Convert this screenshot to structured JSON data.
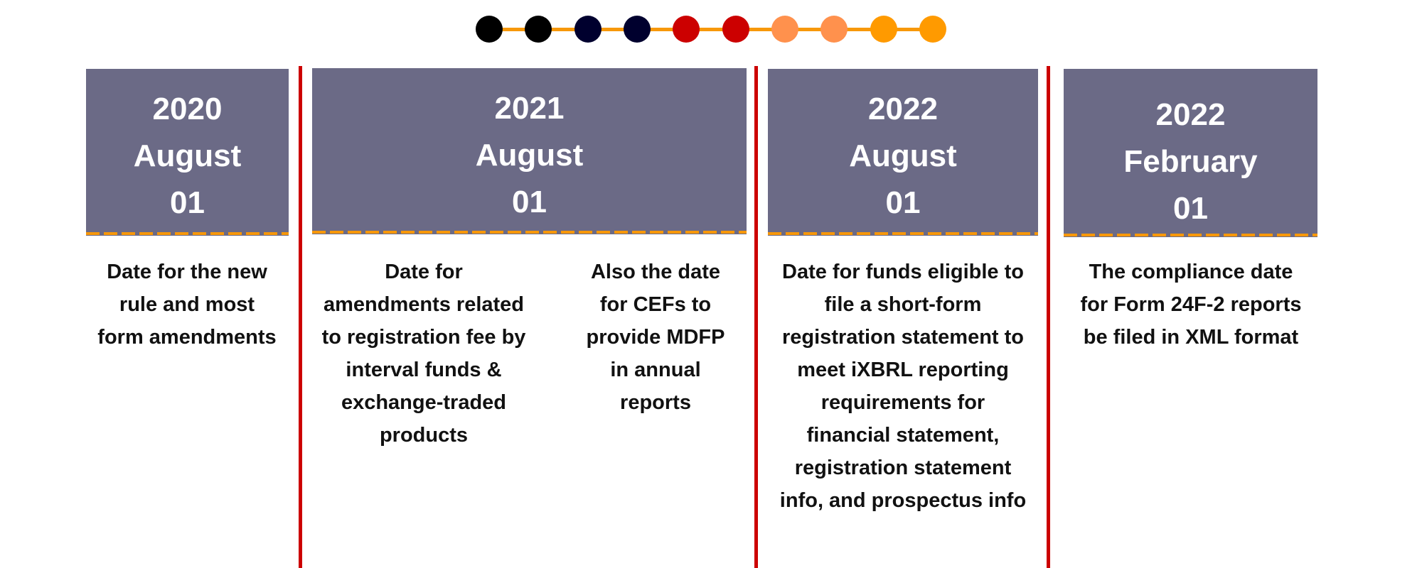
{
  "colors": {
    "box_background": "#6b6a86",
    "box_text": "#ffffff",
    "divider": "#cc0000",
    "dash_accent": "#f7980a",
    "body_text": "#111111",
    "track": "#f7980a"
  },
  "progress_dots": [
    {
      "color": "#000000"
    },
    {
      "color": "#000000"
    },
    {
      "color": "#00002e"
    },
    {
      "color": "#00002e"
    },
    {
      "color": "#cc0000"
    },
    {
      "color": "#cc0000"
    },
    {
      "color": "#ff914d"
    },
    {
      "color": "#ff914d"
    },
    {
      "color": "#ff9a00"
    },
    {
      "color": "#ff9a00"
    }
  ],
  "milestones": [
    {
      "year": "2020",
      "month": "August",
      "day": "01",
      "descriptions": [
        {
          "lines": [
            "Date for the new",
            "rule and most",
            "form amendments"
          ]
        }
      ]
    },
    {
      "year": "2021",
      "month": "August",
      "day": "01",
      "descriptions": [
        {
          "lines": [
            "Date for",
            "amendments related",
            "to registration fee by",
            "interval funds &",
            "exchange-traded",
            "products"
          ]
        },
        {
          "lines": [
            "Also the date",
            "for CEFs to",
            "provide MDFP",
            "in annual",
            "reports"
          ]
        }
      ]
    },
    {
      "year": "2022",
      "month": "August",
      "day": "01",
      "descriptions": [
        {
          "lines": [
            "Date for funds eligible to",
            "file a short-form",
            "registration statement to",
            "meet iXBRL reporting",
            "requirements for",
            "financial statement,",
            "registration statement",
            "info, and prospectus info"
          ]
        }
      ]
    },
    {
      "year": "2022",
      "month": "February",
      "day": "01",
      "descriptions": [
        {
          "lines": [
            "The compliance date",
            "for Form 24F-2 reports",
            "be filed in XML format"
          ]
        }
      ]
    }
  ]
}
